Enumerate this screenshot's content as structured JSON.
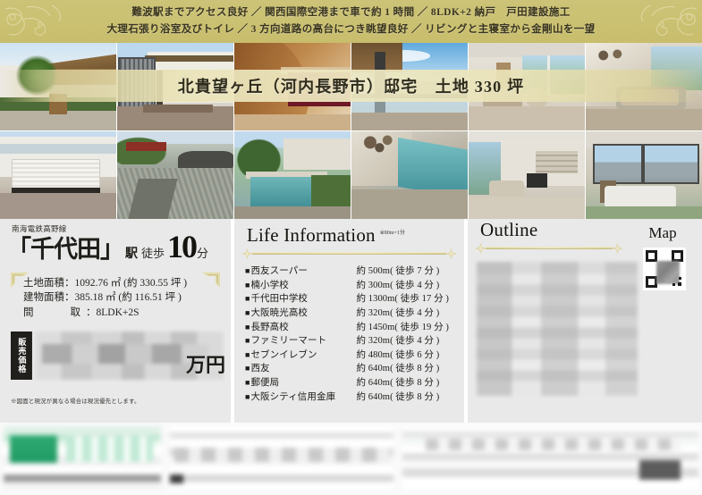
{
  "header": {
    "line1": "難波駅までアクセス良好 ／ 関西国際空港まで車で約 1 時間 ／ 8LDK+2 納戸　戸田建設施工",
    "line2": "大理石張り浴室及びトイレ ／ 3 方向道路の高台につき眺望良好 ／ リビングと主寝室から金剛山を一望",
    "ornament": "flourish-ornament"
  },
  "hero": {
    "title": "北貴望ヶ丘（河内長野市）邸宅　土地 330 坪"
  },
  "photos": [
    {
      "name": "exterior-front-palm"
    },
    {
      "name": "entrance-iron-gate"
    },
    {
      "name": "interior-wood-bedroom"
    },
    {
      "name": "balcony-city-view"
    },
    {
      "name": "living-room-window"
    },
    {
      "name": "marble-bathroom"
    },
    {
      "name": "garage-white-door"
    },
    {
      "name": "japanese-rock-garden"
    },
    {
      "name": "garden-pool-walkway"
    },
    {
      "name": "pool-aerial-view"
    },
    {
      "name": "modern-living-room"
    },
    {
      "name": "master-bedroom-view"
    }
  ],
  "access": {
    "railway_line": "南海電鉄高野線",
    "station_name": "「千代田」",
    "station_suffix": "駅",
    "walk_label": "徒歩",
    "walk_minutes": "10",
    "minutes_unit": "分"
  },
  "specs": {
    "land_area": "土地面積：1092.76 ㎡ (約 330.55 坪 )",
    "building_area": "建物面積：385.18 ㎡ (約 116.51 坪 )",
    "layout_label": "間　　取",
    "layout_value": "：8LDK+2S"
  },
  "price": {
    "tag_label": "販売価格",
    "value_masked": "",
    "unit": "万円"
  },
  "disclaimer": "※図面と現況が異なる場合は現況優先とします。",
  "life_information": {
    "title": "Life Information",
    "note": "※80m=1分",
    "bullet": "■",
    "items": [
      {
        "name": "西友スーパー",
        "distance": "約 500m( 徒歩 7 分 )"
      },
      {
        "name": "楠小学校",
        "distance": "約 300m( 徒歩 4 分 )"
      },
      {
        "name": "千代田中学校",
        "distance": "約 1300m( 徒歩 17 分 )"
      },
      {
        "name": "大阪暁光高校",
        "distance": "約 320m( 徒歩 4 分 )"
      },
      {
        "name": "長野高校",
        "distance": "約 1450m( 徒歩 19 分 )"
      },
      {
        "name": "ファミリーマート",
        "distance": "約 320m( 徒歩 4 分 )"
      },
      {
        "name": "セブンイレブン",
        "distance": "約 480m( 徒歩 6 分 )"
      },
      {
        "name": "西友",
        "distance": "約 640m( 徒歩 8 分 )"
      },
      {
        "name": "郵便局",
        "distance": "約 640m( 徒歩 8 分 )"
      },
      {
        "name": "大阪シティ信用金庫",
        "distance": "約 640m( 徒歩 8 分 )"
      }
    ]
  },
  "outline": {
    "title": "Outline",
    "content_masked": ""
  },
  "map": {
    "title": "Map",
    "qr_code": "qr-code"
  },
  "footer": {
    "block1_masked": "",
    "block2_masked": "",
    "block3_masked": ""
  },
  "colors": {
    "header_gold": "#cbc172",
    "sash_gold": "#eee8c2",
    "panel_gray": "#e9e9e9",
    "price_tag_black": "#211f1c",
    "rule_gold": "#d9d19a",
    "accent_green": "#2faa72"
  }
}
